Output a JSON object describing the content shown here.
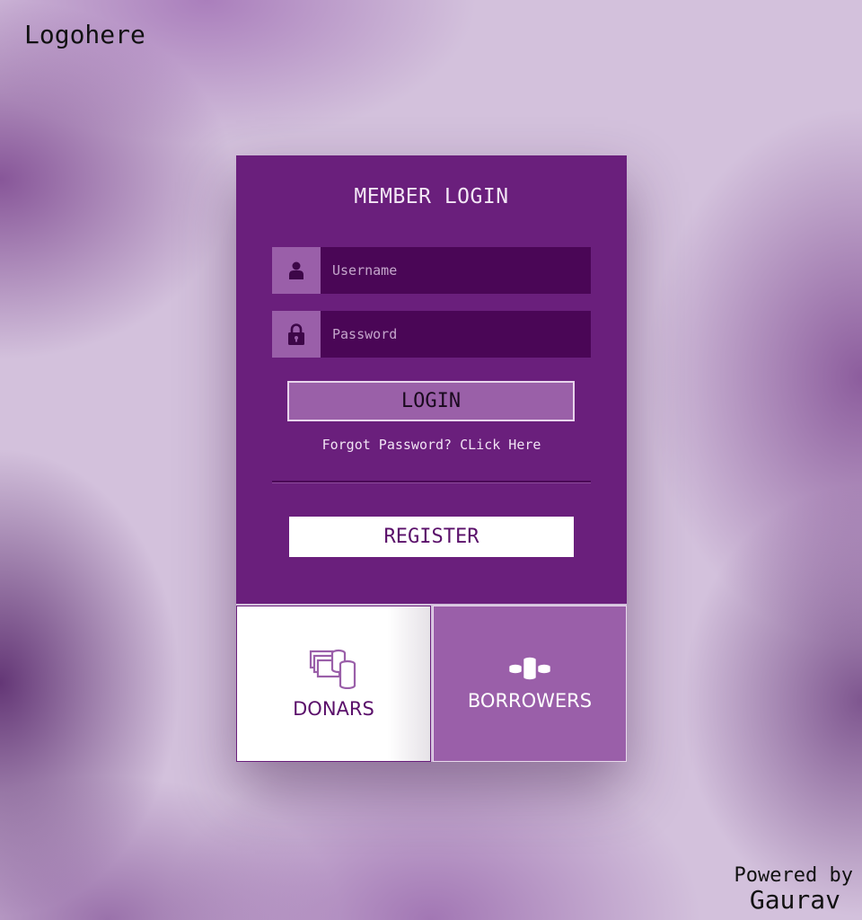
{
  "logo": {
    "text": "Logohere"
  },
  "login": {
    "title": "MEMBER LOGIN",
    "username_placeholder": "Username",
    "password_placeholder": "Password",
    "login_label": "LOGIN",
    "forgot_text": "Forgot Password? CLick Here",
    "register_label": "REGISTER"
  },
  "tiles": {
    "donars": {
      "label": "DONARS",
      "icon": "money-stack-icon"
    },
    "borrowers": {
      "label": "BORROWERS",
      "icon": "coins-icon"
    }
  },
  "footer": {
    "powered_by": "Powered by",
    "author": "Gaurav"
  },
  "colors": {
    "panel": "#6a1f7c",
    "input_bg": "#4a0656",
    "accent_light": "#9a5fa9",
    "text_dark_purple": "#5a0f6a"
  }
}
